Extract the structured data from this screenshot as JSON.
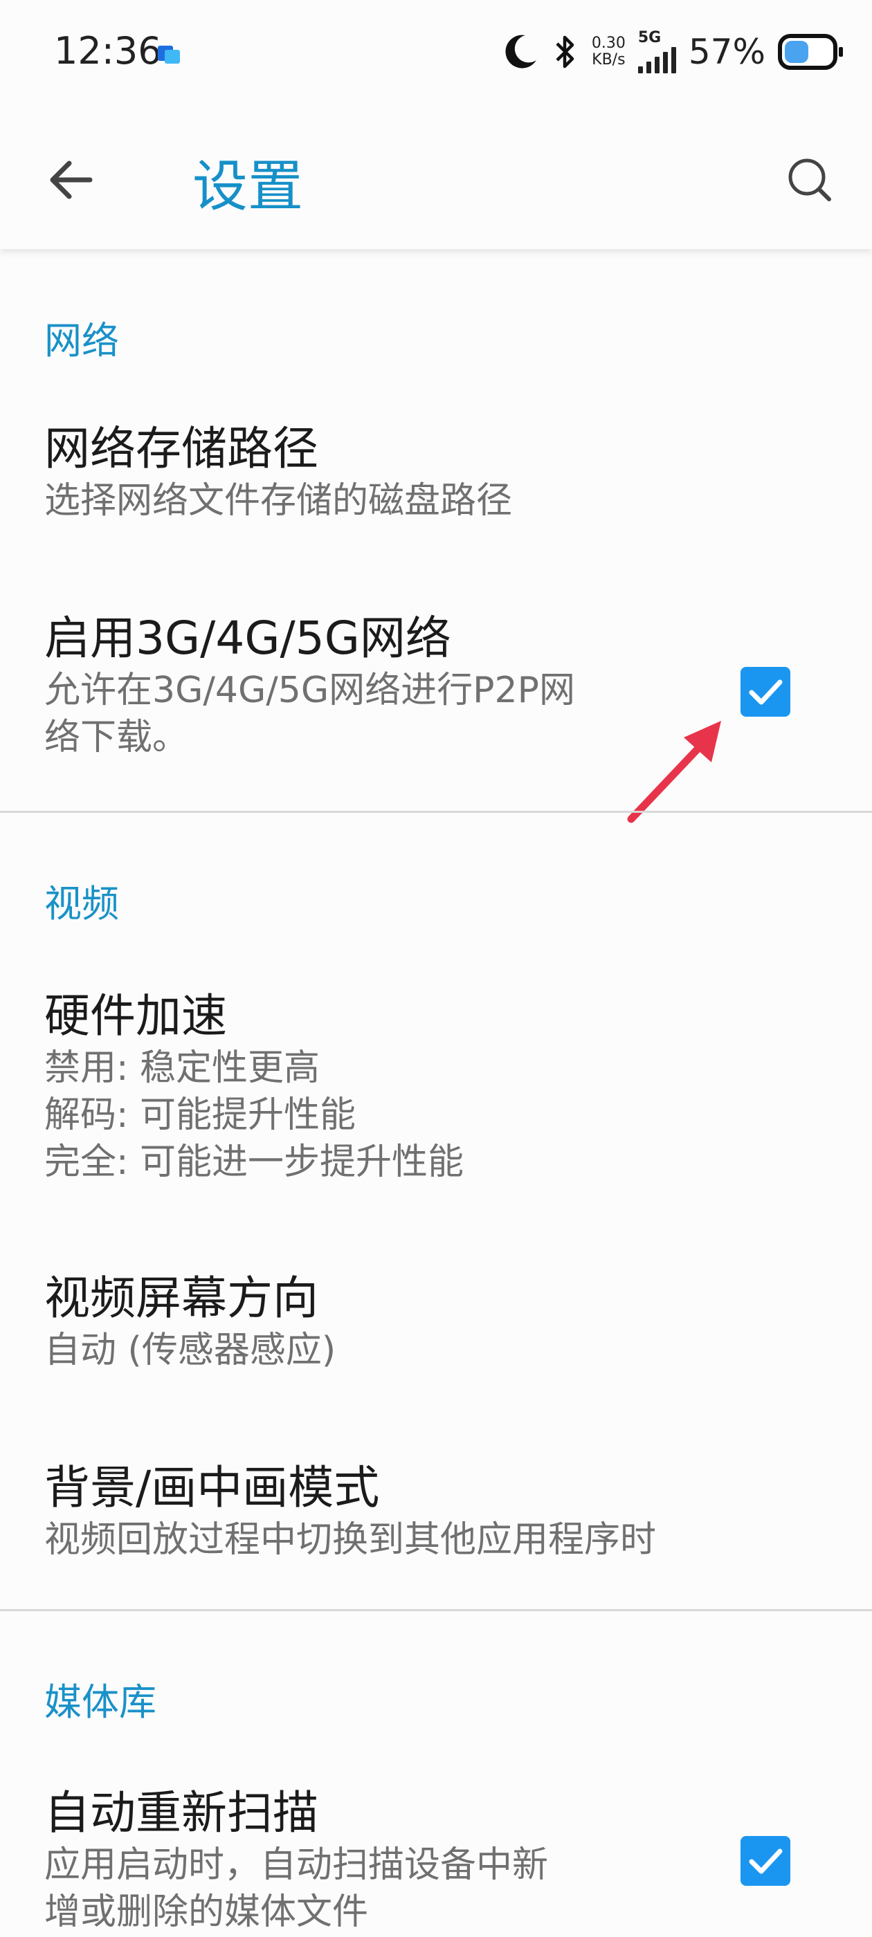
{
  "status_bar": {
    "time": "12:36",
    "speed_value": "0.30",
    "speed_unit": "KB/s",
    "network": "5G",
    "battery": "57%",
    "battery_level": 0.57,
    "icons": [
      "moon-icon",
      "bluetooth-icon",
      "signal-icon",
      "battery-icon"
    ]
  },
  "app_bar": {
    "title": "设置",
    "back_icon": "arrow-left-icon",
    "search_icon": "search-icon"
  },
  "sections": {
    "network": {
      "header": "网络",
      "storage_title": "网络存储路径",
      "storage_summary": "选择网络文件存储的磁盘路径",
      "mobile_title": "启用3G/4G/5G网络",
      "mobile_summary": "允许在3G/4G/5G网络进行P2P网\n络下载。",
      "mobile_checked": true
    },
    "video": {
      "header": "视频",
      "hw_title": "硬件加速",
      "hw_summary": "禁用: 稳定性更高\n解码: 可能提升性能\n完全: 可能进一步提升性能",
      "orient_title": "视频屏幕方向",
      "orient_summary": "自动 (传感器感应)",
      "pip_title": "背景/画中画模式",
      "pip_summary": "视频回放过程中切换到其他应用程序时"
    },
    "media": {
      "header": "媒体库",
      "rescan_title": "自动重新扫描",
      "rescan_summary": "应用启动时，自动扫描设备中新\n增或删除的媒体文件",
      "rescan_checked": true
    }
  },
  "colors": {
    "accent": "#1690c8",
    "checkbox": "#1b96f0",
    "annotation_arrow": "#e8344a"
  }
}
